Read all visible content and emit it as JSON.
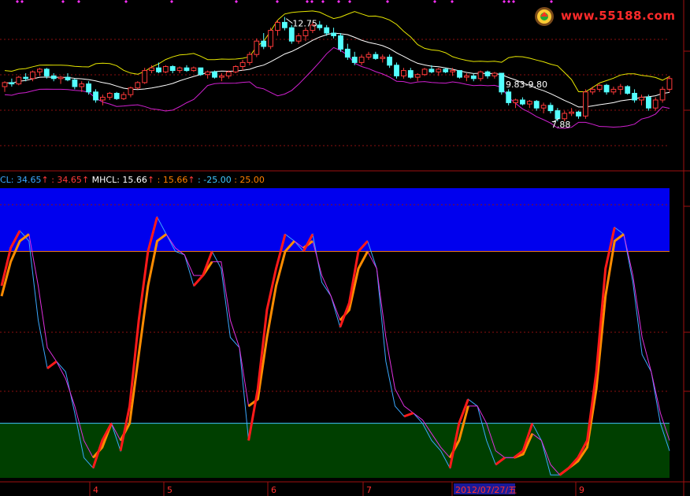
{
  "watermark": {
    "text": "www.55188.com"
  },
  "colors": {
    "background": "#000000",
    "up": "#ff3a3a",
    "down": "#54ffff",
    "ma_mid": "#ffffff",
    "band_upper": "#e6e600",
    "band_lower": "#d020d0",
    "grid": "#8b1010",
    "zone_high": "#0000ee",
    "zone_low": "#003f00",
    "osc_blue": "#3aa8ff",
    "osc_magenta": "#e030e0",
    "osc_red": "#ff1a1a",
    "osc_orange": "#ff8c00",
    "line_orange": "#ff8000",
    "line_cyan": "#40c8ff"
  },
  "legend": {
    "items": [
      {
        "text": "CL: 34.65",
        "color": "#3aa8ff"
      },
      {
        "text": "↑",
        "color": "#ff3a3a"
      },
      {
        "text": " : 34.65",
        "color": "#ff3a3a"
      },
      {
        "text": "↑",
        "color": "#ff3a3a"
      },
      {
        "text": "  MHCL: 15.66",
        "color": "#ffffff"
      },
      {
        "text": "↑",
        "color": "#ff3a3a"
      },
      {
        "text": " : 15.66",
        "color": "#ff8000"
      },
      {
        "text": "↑",
        "color": "#ff3a3a"
      },
      {
        "text": " : -25.00",
        "color": "#40c8ff"
      },
      {
        "text": " : 25.00",
        "color": "#ff8000"
      }
    ]
  },
  "chart_data": [
    {
      "type": "candlestick",
      "annotations": [
        "12.75",
        "9.83-9.80",
        "7.88"
      ],
      "ylim": [
        7.3,
        13.3
      ],
      "ohlc": [
        [
          10.3,
          10.5,
          10.1,
          10.45
        ],
        [
          10.45,
          10.6,
          10.3,
          10.4
        ],
        [
          10.4,
          10.7,
          10.35,
          10.65
        ],
        [
          10.65,
          10.8,
          10.5,
          10.6
        ],
        [
          10.6,
          10.9,
          10.5,
          10.85
        ],
        [
          10.85,
          11.0,
          10.7,
          10.95
        ],
        [
          10.95,
          11.0,
          10.6,
          10.7
        ],
        [
          10.7,
          10.8,
          10.5,
          10.6
        ],
        [
          10.6,
          10.7,
          10.4,
          10.65
        ],
        [
          10.65,
          10.8,
          10.5,
          10.55
        ],
        [
          10.55,
          10.6,
          10.2,
          10.3
        ],
        [
          10.3,
          10.5,
          10.1,
          10.4
        ],
        [
          10.4,
          10.5,
          10.0,
          10.1
        ],
        [
          10.1,
          10.2,
          9.7,
          9.8
        ],
        [
          9.8,
          10.0,
          9.6,
          9.9
        ],
        [
          9.9,
          10.1,
          9.8,
          10.05
        ],
        [
          10.05,
          10.1,
          9.8,
          9.85
        ],
        [
          9.85,
          10.1,
          9.8,
          10.0
        ],
        [
          10.0,
          10.3,
          9.9,
          10.25
        ],
        [
          10.25,
          10.5,
          10.2,
          10.45
        ],
        [
          10.45,
          11.0,
          10.4,
          10.9
        ],
        [
          10.9,
          11.1,
          10.8,
          11.0
        ],
        [
          11.0,
          11.2,
          10.8,
          10.85
        ],
        [
          10.85,
          11.1,
          10.8,
          11.05
        ],
        [
          11.05,
          11.1,
          10.8,
          10.9
        ],
        [
          10.9,
          11.05,
          10.8,
          11.0
        ],
        [
          11.0,
          11.1,
          10.85,
          10.9
        ],
        [
          10.9,
          11.05,
          10.85,
          11.0
        ],
        [
          11.0,
          11.0,
          10.7,
          10.75
        ],
        [
          10.75,
          10.9,
          10.6,
          10.85
        ],
        [
          10.85,
          10.9,
          10.6,
          10.65
        ],
        [
          10.65,
          10.8,
          10.5,
          10.7
        ],
        [
          10.7,
          10.9,
          10.6,
          10.85
        ],
        [
          10.85,
          11.1,
          10.8,
          11.05
        ],
        [
          11.05,
          11.3,
          10.9,
          11.2
        ],
        [
          11.2,
          11.6,
          11.1,
          11.5
        ],
        [
          11.5,
          12.1,
          11.4,
          12.0
        ],
        [
          12.0,
          12.3,
          11.7,
          11.8
        ],
        [
          11.8,
          12.5,
          11.7,
          12.4
        ],
        [
          12.4,
          12.8,
          12.2,
          12.7
        ],
        [
          12.7,
          12.9,
          12.4,
          12.5
        ],
        [
          12.5,
          12.6,
          11.9,
          12.0
        ],
        [
          12.0,
          12.3,
          11.9,
          12.2
        ],
        [
          12.2,
          12.5,
          12.0,
          12.4
        ],
        [
          12.4,
          12.7,
          12.3,
          12.6
        ],
        [
          12.6,
          12.75,
          12.4,
          12.5
        ],
        [
          12.5,
          12.6,
          12.2,
          12.3
        ],
        [
          12.3,
          12.5,
          12.1,
          12.2
        ],
        [
          12.2,
          12.3,
          11.6,
          11.7
        ],
        [
          11.7,
          11.9,
          11.3,
          11.4
        ],
        [
          11.4,
          11.6,
          11.1,
          11.2
        ],
        [
          11.2,
          11.5,
          11.1,
          11.4
        ],
        [
          11.4,
          11.6,
          11.3,
          11.5
        ],
        [
          11.5,
          11.6,
          11.3,
          11.35
        ],
        [
          11.35,
          11.5,
          11.2,
          11.4
        ],
        [
          11.4,
          11.5,
          11.0,
          11.1
        ],
        [
          11.1,
          11.2,
          10.6,
          10.7
        ],
        [
          10.7,
          11.0,
          10.6,
          10.9
        ],
        [
          10.9,
          11.0,
          10.6,
          10.65
        ],
        [
          10.65,
          10.8,
          10.5,
          10.75
        ],
        [
          10.75,
          11.0,
          10.7,
          10.95
        ],
        [
          10.95,
          11.1,
          10.8,
          10.85
        ],
        [
          10.85,
          11.0,
          10.7,
          10.95
        ],
        [
          10.95,
          11.0,
          10.8,
          10.85
        ],
        [
          10.85,
          11.0,
          10.7,
          10.9
        ],
        [
          10.9,
          10.9,
          10.6,
          10.65
        ],
        [
          10.65,
          10.8,
          10.5,
          10.7
        ],
        [
          10.7,
          10.8,
          10.5,
          10.6
        ],
        [
          10.6,
          10.9,
          10.5,
          10.85
        ],
        [
          10.85,
          10.9,
          10.6,
          10.7
        ],
        [
          10.7,
          10.85,
          10.6,
          10.8
        ],
        [
          10.8,
          10.8,
          10.0,
          10.1
        ],
        [
          10.1,
          10.2,
          9.6,
          9.7
        ],
        [
          9.7,
          9.85,
          9.5,
          9.8
        ],
        [
          9.8,
          9.9,
          9.6,
          9.65
        ],
        [
          9.65,
          9.8,
          9.5,
          9.75
        ],
        [
          9.75,
          9.8,
          9.4,
          9.5
        ],
        [
          9.5,
          9.7,
          9.3,
          9.6
        ],
        [
          9.6,
          9.7,
          9.3,
          9.4
        ],
        [
          9.4,
          9.5,
          9.0,
          9.1
        ],
        [
          9.1,
          9.4,
          9.0,
          9.3
        ],
        [
          9.3,
          9.5,
          9.2,
          9.35
        ],
        [
          9.35,
          9.4,
          9.1,
          9.2
        ],
        [
          9.2,
          10.2,
          9.1,
          10.1
        ],
        [
          10.1,
          10.3,
          10.0,
          10.2
        ],
        [
          10.2,
          10.4,
          10.1,
          10.35
        ],
        [
          10.35,
          10.4,
          10.0,
          10.1
        ],
        [
          10.1,
          10.3,
          10.0,
          10.2
        ],
        [
          10.2,
          10.4,
          10.0,
          10.3
        ],
        [
          10.3,
          10.35,
          10.0,
          10.05
        ],
        [
          10.05,
          10.2,
          9.7,
          9.8
        ],
        [
          9.8,
          10.0,
          9.6,
          9.9
        ],
        [
          9.9,
          10.0,
          9.4,
          9.5
        ],
        [
          9.5,
          9.9,
          9.4,
          9.8
        ],
        [
          9.8,
          10.3,
          9.7,
          10.2
        ],
        [
          10.2,
          10.7,
          10.1,
          10.6
        ]
      ]
    },
    {
      "type": "line",
      "ylim": [
        -45,
        45
      ],
      "zones": {
        "upper": 25,
        "lower": -25
      },
      "series": [
        {
          "values": [
            15,
            26,
            31,
            28,
            5,
            -9,
            -7,
            -10,
            -22,
            -35,
            -38,
            -30,
            -25,
            -33,
            -20,
            5,
            25,
            35,
            30,
            25,
            24,
            15,
            18,
            25,
            20,
            0,
            -3,
            -30,
            -15,
            8,
            20,
            30,
            28,
            25,
            30,
            16,
            12,
            3,
            10,
            25,
            28,
            20,
            -7,
            -20,
            -23,
            -22,
            -25,
            -30,
            -33,
            -38,
            -25,
            -18,
            -20,
            -30,
            -37,
            -35,
            -35,
            -33,
            -25,
            -30,
            -40,
            -40,
            -38,
            -35,
            -30,
            -10,
            20,
            32,
            30,
            16,
            -5,
            -10,
            -25,
            -33
          ]
        },
        {
          "values": [
            12,
            22,
            28,
            30,
            15,
            -3,
            -7,
            -12,
            -20,
            -30,
            -35,
            -32,
            -25,
            -30,
            -25,
            -5,
            15,
            28,
            30,
            26,
            24,
            18,
            18,
            22,
            22,
            5,
            -3,
            -20,
            -18,
            0,
            15,
            25,
            28,
            26,
            28,
            18,
            12,
            5,
            8,
            20,
            25,
            20,
            0,
            -15,
            -20,
            -22,
            -24,
            -28,
            -32,
            -35,
            -30,
            -20,
            -20,
            -25,
            -33,
            -35,
            -35,
            -34,
            -28,
            -30,
            -37,
            -40,
            -38,
            -36,
            -32,
            -15,
            12,
            28,
            30,
            18,
            0,
            -10,
            -22,
            -30
          ]
        },
        {
          "values": [
            20,
            33,
            28,
            -7,
            -3,
            -24,
            -21,
            25,
            8,
            -3,
            25,
            36,
            -3,
            30,
            -3,
            0,
            -38,
            -24,
            -2,
            7,
            9,
            14,
            -30,
            6
          ]
        },
        {
          "values": [
            15,
            28,
            30,
            -7,
            -3,
            -24,
            -22,
            -14,
            -3,
            5,
            20,
            -3,
            10,
            14,
            -3,
            -13,
            -21,
            -36,
            -35,
            -32,
            3,
            30,
            18,
            -3
          ]
        }
      ]
    }
  ],
  "xaxis": {
    "labels": [
      "4",
      "5",
      "6",
      "7",
      "2012/07/27/五",
      "9"
    ]
  }
}
